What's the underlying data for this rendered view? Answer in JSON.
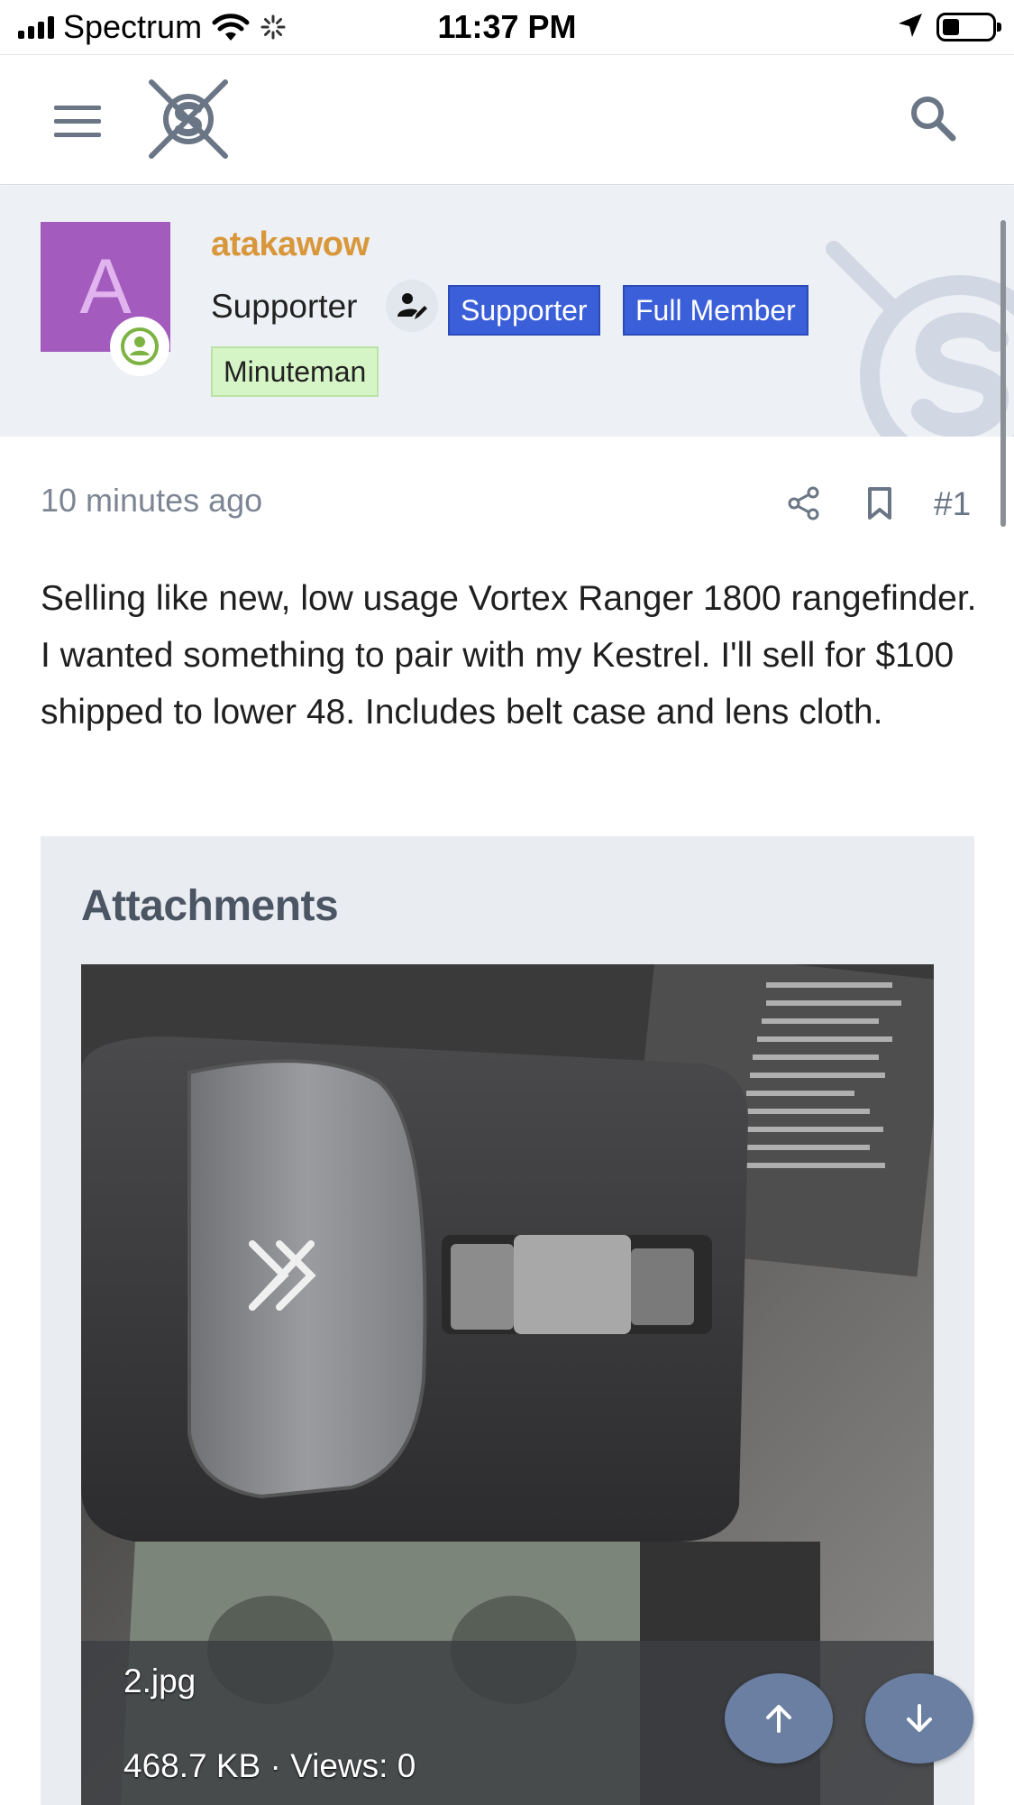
{
  "status_bar": {
    "carrier": "Spectrum",
    "time": "11:37 PM"
  },
  "navbar": {
    "menu_icon": "hamburger-icon",
    "logo_icon": "site-logo",
    "search_icon": "search-icon"
  },
  "post": {
    "author": {
      "avatar_letter": "A",
      "avatar_color": "#a35bbd",
      "username": "atakawow",
      "user_title": "Supporter",
      "banners": [
        {
          "label": "Supporter",
          "style": "blue"
        },
        {
          "label": "Full Member",
          "style": "blue"
        },
        {
          "label": "Minuteman",
          "style": "green"
        }
      ]
    },
    "timestamp": "10 minutes ago",
    "number": "#1",
    "body": "Selling like new, low usage Vortex Ranger 1800 rangefinder. I wanted something to pair with my Kestrel. I'll sell for $100 shipped to lower 48. Includes belt case and lens cloth.",
    "attachments": {
      "title": "Attachments",
      "items": [
        {
          "filename": "2.jpg",
          "meta": "468.7 KB · Views: 0"
        }
      ]
    }
  },
  "colors": {
    "username": "#d9973b",
    "badge_blue": "#3a5fd8",
    "badge_green": "#d6f5c7",
    "header_bg": "#edf0f5",
    "fab": "#6a7fa2"
  }
}
